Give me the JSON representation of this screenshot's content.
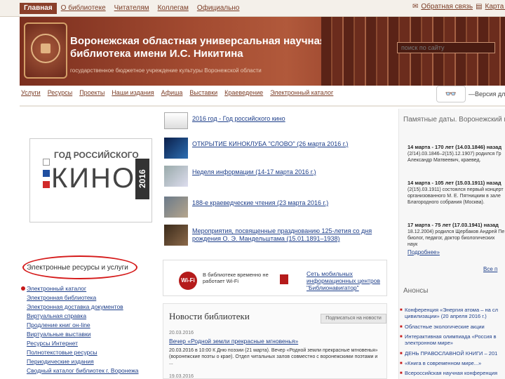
{
  "topnav": [
    "Главная",
    "О библиотеке",
    "Читателям",
    "Коллегам",
    "Официально"
  ],
  "topright": {
    "feedback": "Обратная связь",
    "map": "Карта с"
  },
  "header": {
    "title": "Воронежская областная универсальная научная библиотека имени И.С. Никитина",
    "subtitle": "государственное бюджетное учреждение культуры Воронежской области"
  },
  "search": {
    "placeholder": "поиск по сайту"
  },
  "mainnav": [
    "Услуги",
    "Ресурсы",
    "Проекты",
    "Наши издания",
    "Афиша",
    "Выставки",
    "Краеведение",
    "Электронный каталог"
  ],
  "version": "—Версия для с",
  "banner": {
    "god": "ГОД РОССИЙСКОГО",
    "kino": "КИНО",
    "year": "2016"
  },
  "news": [
    "2016 год - Год российского кино",
    "ОТКРЫТИЕ КИНОКЛУБА \"СЛОВО\" (26 марта 2016 г.)",
    "Неделя информации (14-17 марта 2016 г.)",
    "188-е краеведческие чтения (23 марта 2016 г.)",
    "Мероприятия, посвященные празднованию 125-летия со дня рождения О. Э. Мандельштама (15.01.1891–1938)"
  ],
  "resources": {
    "title": "Электронные ресурсы и услуги",
    "items": [
      "Электронный каталог",
      "Электронная библиотека",
      "Электронная доставка документов",
      "Виртуальная справка",
      "Продление книг он-line",
      "Виртуальные выставки",
      "Ресурсы Интернет",
      "Полнотекстовые ресурсы",
      "Периодические издания",
      "Сводный каталог библиотек г. Воронежа"
    ]
  },
  "info": {
    "wifi_label": "Wi-Fi",
    "wifi_text": "В библиотеке временно не работает Wi-Fi",
    "mobile_link": "Сеть мобильных информационных центров \"Библионавигатор\""
  },
  "library_news": {
    "title": "Новости библиотеки",
    "subscribe": "Подписаться на новости",
    "date1": "20.03.2016",
    "headline1": "Вечер «Родной земли прекрасные мгновенья»",
    "text1": "20.03.2016 в 10:00 К Дню поэзии (21 марта). Вечер «Родной земли прекрасные мгновенья» (воронежские поэты о крае). Отдел читальных залов совместно с воронежскими поэтами и ...",
    "date2": "19.03.2016"
  },
  "right": {
    "dates_title": "Памятные даты. Воронежский к",
    "d1_bold": "14 марта - 170 лет (14.03.1846) назад",
    "d1_text": "(2/14).03.1846–2(15).12.1907) родился Гр Александр Матвеевич, краевед.",
    "d2_bold": "14 марта - 105 лет (15.03.1911) назад",
    "d2_text": "(2(15).03.1911) состоялся первый концерт организованного М. Е. Пятницким в зале Благородного собрания (Москва).",
    "d3_bold": "17 марта - 75 лет (17.03.1941) назад",
    "d3_text": "18.12.2004) родился Щербаков Андрей Пе биолог, педагог, доктор биологических наук",
    "more": "Подробнее»",
    "all": "Все п",
    "announce_title": "Анонсы",
    "announces": [
      "Конференция «Энергия атома – на сл цивилизации» (20 апреля 2016 г.)",
      "Областные экологические акции",
      "Интерактивная олимпиада «Россия в электронном мире»",
      "ДЕНЬ ПРАВОСЛАВНОЙ КНИГИ – 201",
      "«Книга в современном мире...»",
      "Всероссийская научная конференция"
    ]
  }
}
